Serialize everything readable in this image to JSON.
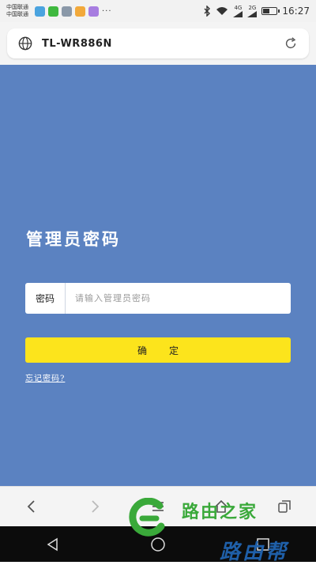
{
  "status_bar": {
    "carrier_1": "中国联通",
    "carrier_2": "中国联通",
    "network_a": "4G",
    "network_b": "2G",
    "time": "16:27",
    "overflow": "···"
  },
  "address_bar": {
    "url": "TL-WR886N"
  },
  "login": {
    "title": "管理员密码",
    "password_label": "密码",
    "password_placeholder": "请输入管理员密码",
    "password_value": "",
    "confirm_label": "确定",
    "forgot_link": "忘记密码?"
  },
  "watermark": {
    "text_1": "路由之家",
    "text_2": "路由帮"
  },
  "colors": {
    "page_background": "#5b82c1",
    "confirm_button": "#fce41c"
  },
  "icons": {
    "address": "globe-icon",
    "reload": "reload-icon",
    "nav_back": "chevron-left-icon",
    "nav_forward": "chevron-right-icon",
    "nav_menu": "menu-icon",
    "nav_home": "home-icon",
    "nav_tabs": "tabs-icon"
  }
}
